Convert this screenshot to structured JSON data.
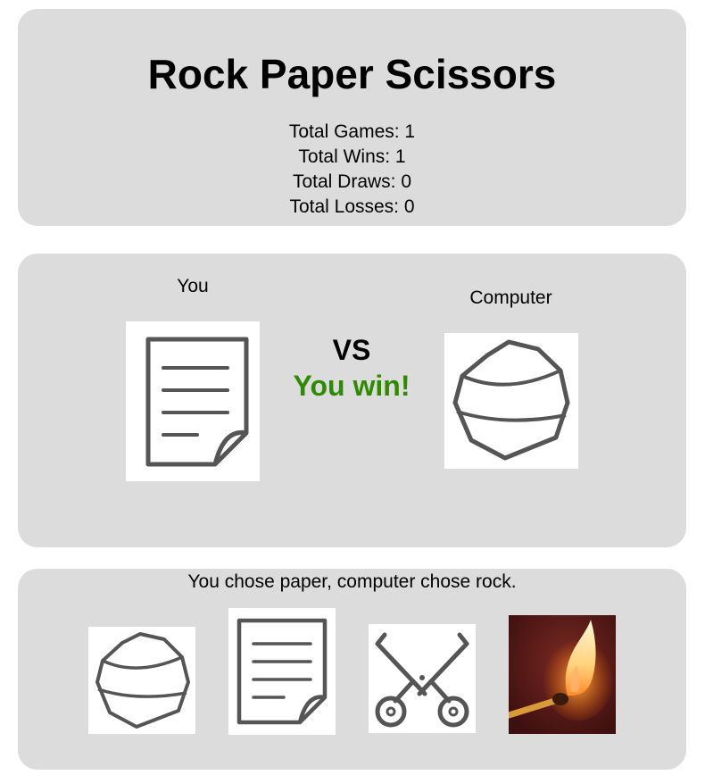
{
  "title": "Rock Paper Scissors",
  "stats": {
    "games": "Total Games: 1",
    "wins": "Total Wins: 1",
    "draws": "Total Draws: 0",
    "losses": "Total Losses: 0"
  },
  "arena": {
    "you_label": "You",
    "computer_label": "Computer",
    "vs": "VS",
    "result": "You win!",
    "result_color": "#2e8b00",
    "player_choice_icon": "paper-icon",
    "computer_choice_icon": "rock-icon"
  },
  "choices": {
    "message": "You chose paper, computer chose rock.",
    "options": [
      "rock-icon",
      "paper-icon",
      "scissors-icon",
      "match-icon"
    ]
  },
  "colors": {
    "panel": "#dcdcdc",
    "icon_stroke": "#555555"
  }
}
